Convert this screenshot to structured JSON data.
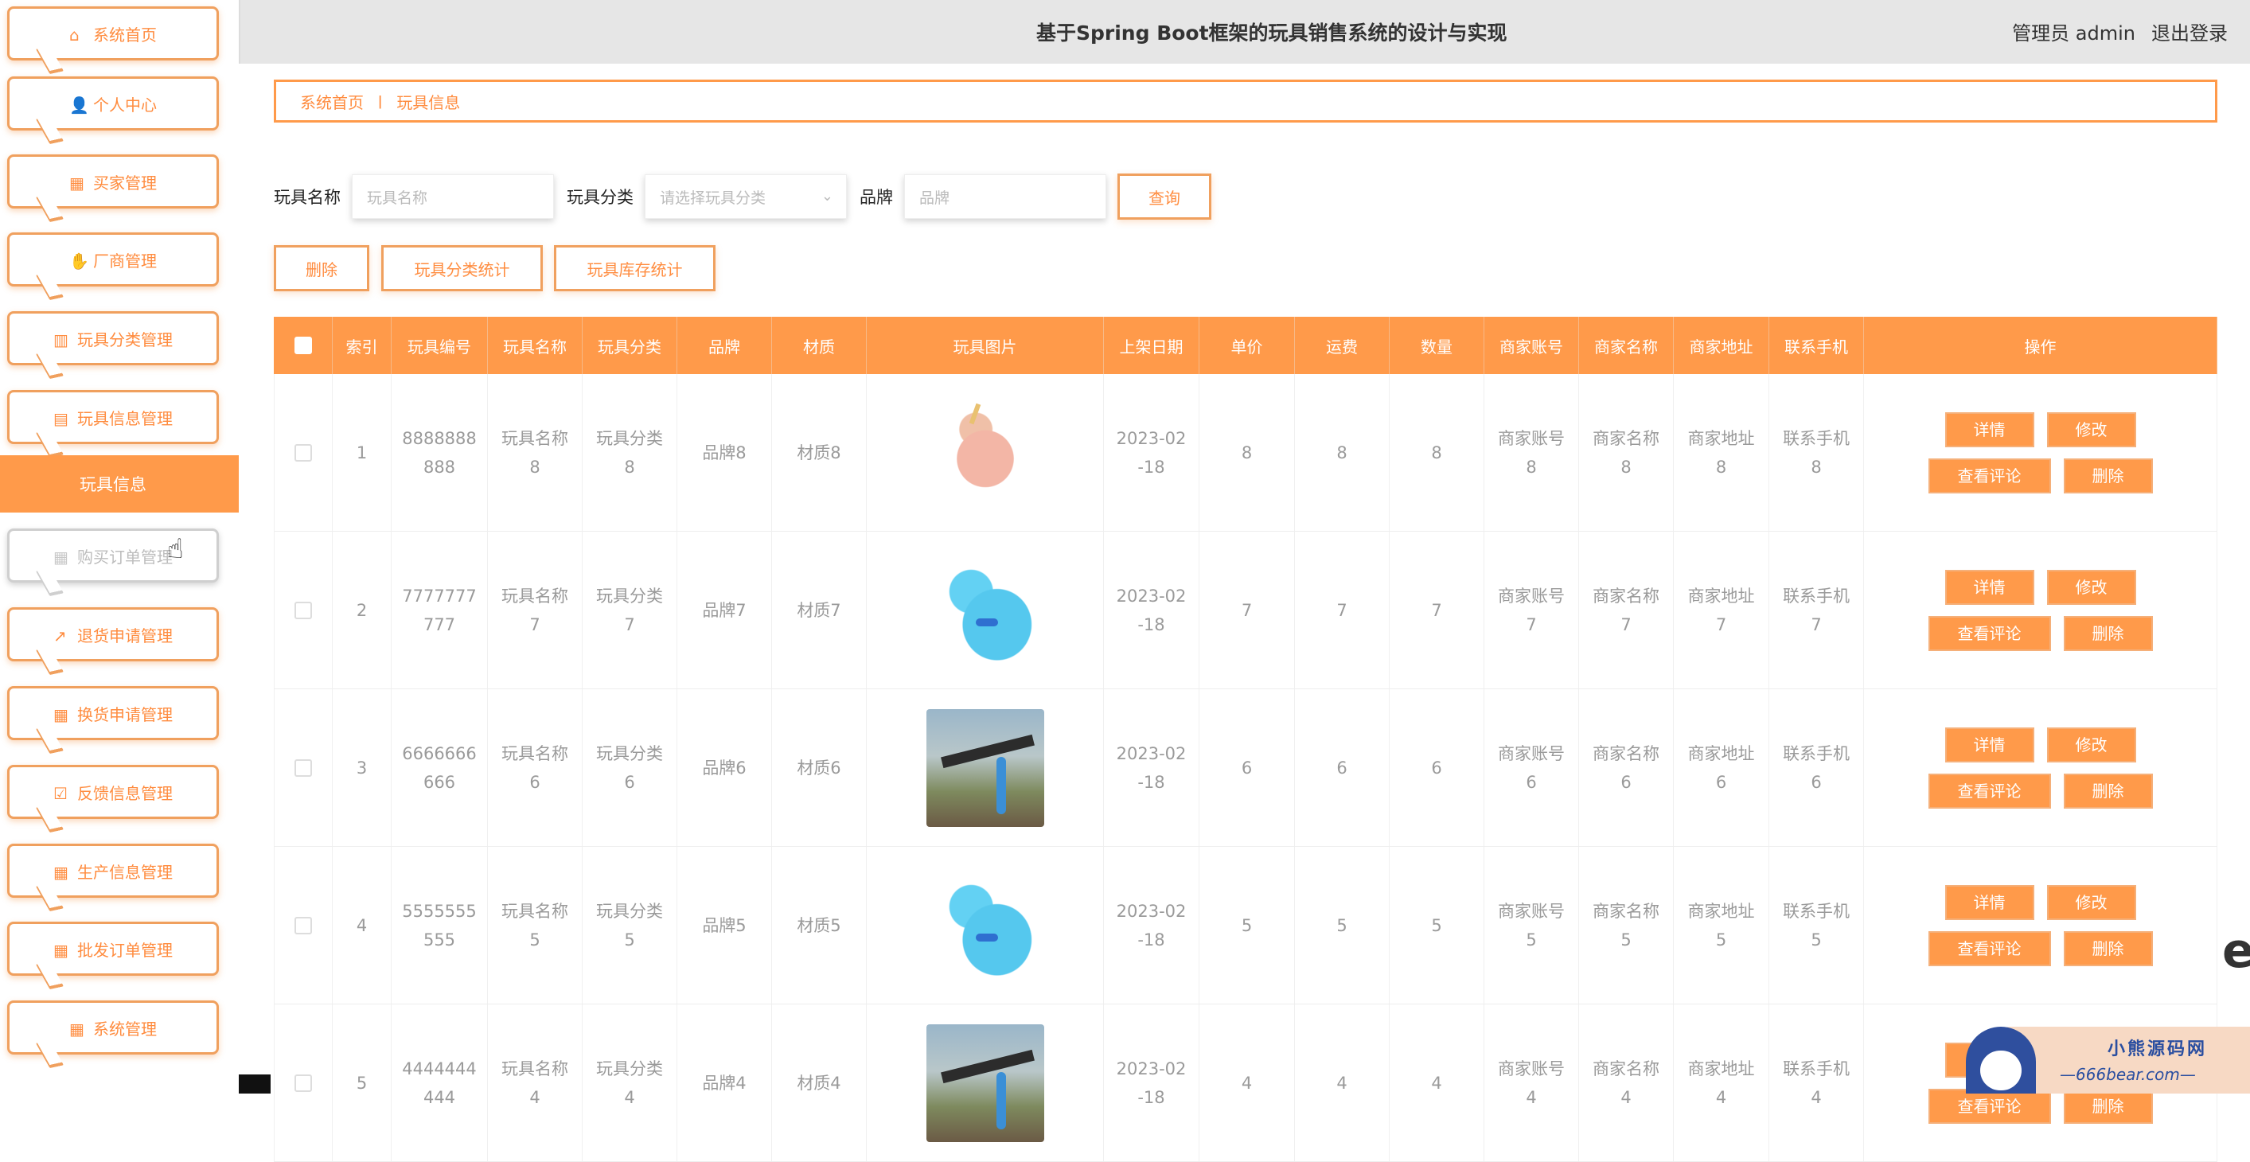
{
  "app_title": "基于Spring Boot框架的玩具销售系统的设计与实现",
  "user": {
    "role_label": "管理员 admin",
    "logout": "退出登录"
  },
  "sidebar": {
    "items": [
      {
        "label": "系统首页",
        "icon": "home-icon"
      },
      {
        "label": "个人中心",
        "icon": "user-icon"
      },
      {
        "label": "买家管理",
        "icon": "grid-icon"
      },
      {
        "label": "厂商管理",
        "icon": "thumb-icon"
      },
      {
        "label": "玩具分类管理",
        "icon": "bar-icon"
      },
      {
        "label": "玩具信息管理",
        "icon": "clipboard-icon"
      },
      {
        "label": "购买订单管理",
        "icon": "grid-icon"
      },
      {
        "label": "退货申请管理",
        "icon": "chart-icon"
      },
      {
        "label": "换货申请管理",
        "icon": "grid-icon"
      },
      {
        "label": "反馈信息管理",
        "icon": "clipboard-check-icon"
      },
      {
        "label": "生产信息管理",
        "icon": "grid-icon"
      },
      {
        "label": "批发订单管理",
        "icon": "grid-9-icon"
      },
      {
        "label": "系统管理",
        "icon": "grid-icon"
      }
    ],
    "active_sub": "玩具信息"
  },
  "breadcrumb": {
    "home": "系统首页",
    "separator": "ǀ",
    "current": "玩具信息"
  },
  "search": {
    "name_label": "玩具名称",
    "name_placeholder": "玩具名称",
    "category_label": "玩具分类",
    "category_placeholder": "请选择玩具分类",
    "brand_label": "品牌",
    "brand_placeholder": "品牌",
    "query": "查询"
  },
  "actions": {
    "delete": "删除",
    "category_stats": "玩具分类统计",
    "stock_stats": "玩具库存统计"
  },
  "table": {
    "headers": [
      "",
      "索引",
      "玩具编号",
      "玩具名称",
      "玩具分类",
      "品牌",
      "材质",
      "玩具图片",
      "上架日期",
      "单价",
      "运费",
      "数量",
      "商家账号",
      "商家名称",
      "商家地址",
      "联系手机",
      "操作"
    ],
    "op_labels": {
      "detail": "详情",
      "edit": "修改",
      "comments": "查看评论",
      "delete": "删除"
    },
    "rows": [
      {
        "index": "1",
        "code": "8888888\n888",
        "name": "玩具名称\n8",
        "category": "玩具分类\n8",
        "brand": "品牌8",
        "material": "材质8",
        "image": "unicorn",
        "date": "2023-02\n-18",
        "price": "8",
        "shipping": "8",
        "qty": "8",
        "account": "商家账号\n8",
        "shop": "商家名称\n8",
        "address": "商家地址\n8",
        "phone": "联系手机\n8"
      },
      {
        "index": "2",
        "code": "7777777\n777",
        "name": "玩具名称\n7",
        "category": "玩具分类\n7",
        "brand": "品牌7",
        "material": "材质7",
        "image": "dog",
        "date": "2023-02\n-18",
        "price": "7",
        "shipping": "7",
        "qty": "7",
        "account": "商家账号\n7",
        "shop": "商家名称\n7",
        "address": "商家地址\n7",
        "phone": "联系手机\n7"
      },
      {
        "index": "3",
        "code": "6666666\n666",
        "name": "玩具名称\n6",
        "category": "玩具分类\n6",
        "brand": "品牌6",
        "material": "材质6",
        "image": "gun",
        "date": "2023-02\n-18",
        "price": "6",
        "shipping": "6",
        "qty": "6",
        "account": "商家账号\n6",
        "shop": "商家名称\n6",
        "address": "商家地址\n6",
        "phone": "联系手机\n6"
      },
      {
        "index": "4",
        "code": "5555555\n555",
        "name": "玩具名称\n5",
        "category": "玩具分类\n5",
        "brand": "品牌5",
        "material": "材质5",
        "image": "dog",
        "date": "2023-02\n-18",
        "price": "5",
        "shipping": "5",
        "qty": "5",
        "account": "商家账号\n5",
        "shop": "商家名称\n5",
        "address": "商家地址\n5",
        "phone": "联系手机\n5"
      },
      {
        "index": "5",
        "code": "4444444\n444",
        "name": "玩具名称\n4",
        "category": "玩具分类\n4",
        "brand": "品牌4",
        "material": "材质4",
        "image": "gun",
        "date": "2023-02\n-18",
        "price": "4",
        "shipping": "4",
        "qty": "4",
        "account": "商家账号\n4",
        "shop": "商家名称\n4",
        "address": "商家地址\n4",
        "phone": "联系手机\n4"
      }
    ]
  },
  "watermark": {
    "title": "小熊源码网",
    "url": "—666bear.com—"
  },
  "colors": {
    "accent": "#ff9a4a",
    "accent_text": "#ff8c3f",
    "header_bg": "#e6e6e6"
  }
}
